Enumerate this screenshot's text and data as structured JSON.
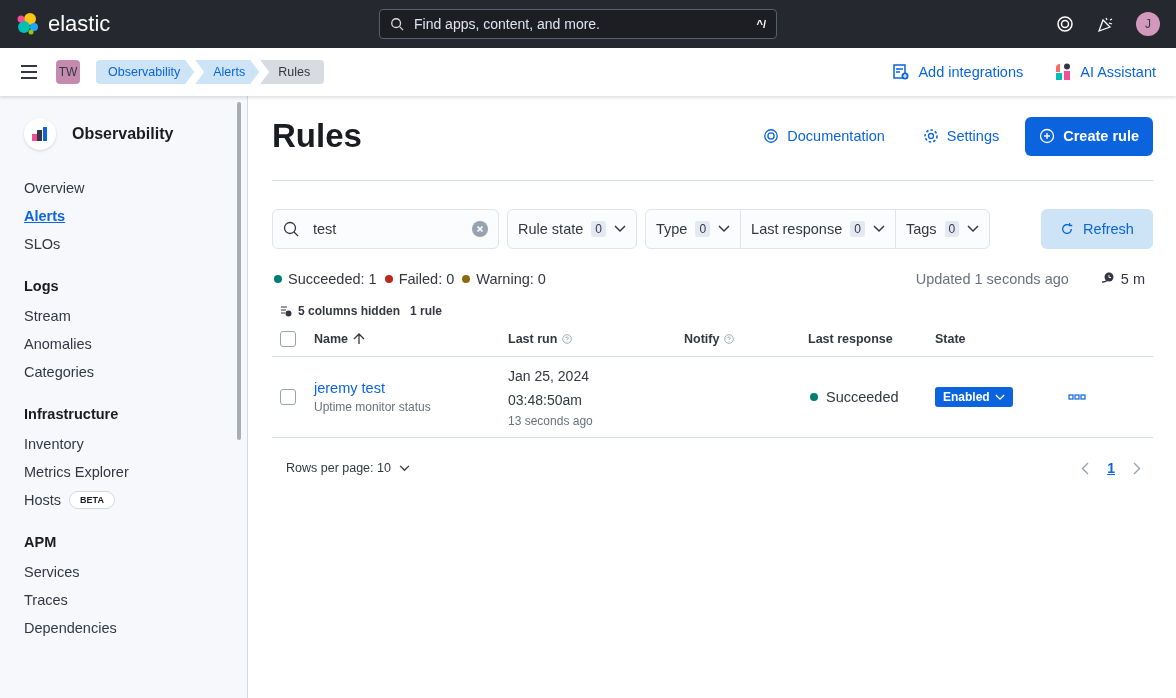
{
  "header": {
    "logo_text": "elastic",
    "search_placeholder": "Find apps, content, and more.",
    "shortcut": "^/",
    "avatar": "J"
  },
  "subheader": {
    "space": "TW",
    "breadcrumbs": [
      {
        "label": "Observability",
        "selected": false
      },
      {
        "label": "Alerts",
        "selected": false
      },
      {
        "label": "Rules",
        "selected": true
      }
    ],
    "actions": [
      {
        "kind": "integrations",
        "label": "Add integrations"
      },
      {
        "kind": "assistant",
        "label": "AI Assistant"
      }
    ]
  },
  "sidebar": {
    "title": "Observability",
    "sections": [
      {
        "items": [
          {
            "label": "Overview",
            "selected": false
          },
          {
            "label": "Alerts",
            "selected": true
          },
          {
            "label": "SLOs",
            "selected": false
          }
        ]
      },
      {
        "heading": "Logs",
        "items": [
          {
            "label": "Stream",
            "selected": false
          },
          {
            "label": "Anomalies",
            "selected": false
          },
          {
            "label": "Categories",
            "selected": false
          }
        ]
      },
      {
        "heading": "Infrastructure",
        "items": [
          {
            "label": "Inventory",
            "selected": false
          },
          {
            "label": "Metrics Explorer",
            "selected": false
          },
          {
            "label": "Hosts",
            "selected": false,
            "badge": "BETA"
          }
        ]
      },
      {
        "heading": "APM",
        "items": [
          {
            "label": "Services",
            "selected": false
          },
          {
            "label": "Traces",
            "selected": false
          },
          {
            "label": "Dependencies",
            "selected": false
          }
        ]
      }
    ]
  },
  "page": {
    "title": "Rules",
    "actions": [
      {
        "kind": "documentation",
        "label": "Documentation"
      },
      {
        "kind": "settings",
        "label": "Settings"
      },
      {
        "kind": "create",
        "label": "Create rule"
      }
    ]
  },
  "toolbar": {
    "search_value": "test",
    "filter_groups": [
      [
        {
          "label": "Rule state",
          "count": "0"
        }
      ],
      [
        {
          "label": "Type",
          "count": "0"
        },
        {
          "label": "Last response",
          "count": "0"
        },
        {
          "label": "Tags",
          "count": "0"
        }
      ]
    ],
    "refresh": "Refresh"
  },
  "status": {
    "counts": [
      {
        "label": "Succeeded: 1",
        "color": "#017d73"
      },
      {
        "label": "Failed: 0",
        "color": "#bd271e"
      },
      {
        "label": "Warning: 0",
        "color": "#8a6a0a"
      }
    ],
    "updated": "Updated 1 seconds ago",
    "interval": "5 m"
  },
  "table": {
    "hidden_columns": "5 columns hidden",
    "count": "1 rule",
    "all_checked": false,
    "columns": [
      {
        "label": "Name",
        "sorted": true,
        "help": false
      },
      {
        "label": "Last run",
        "sorted": false,
        "help": true
      },
      {
        "label": "Notify",
        "sorted": false,
        "help": true
      },
      {
        "label": "Last response",
        "sorted": false,
        "help": false
      },
      {
        "label": "State",
        "sorted": false,
        "help": false
      }
    ],
    "rows": [
      {
        "checked": false,
        "name": "jeremy test",
        "type": "Uptime monitor status",
        "date": "Jan 25, 2024",
        "time": "03:48:50am",
        "ago": "13 seconds ago",
        "response": {
          "label": "Succeeded",
          "color": "#017d73"
        },
        "state": "Enabled"
      }
    ]
  },
  "pagination": {
    "rows_per_page": "Rows per page: 10",
    "pages": [
      {
        "label": "1",
        "selected": true
      }
    ]
  }
}
